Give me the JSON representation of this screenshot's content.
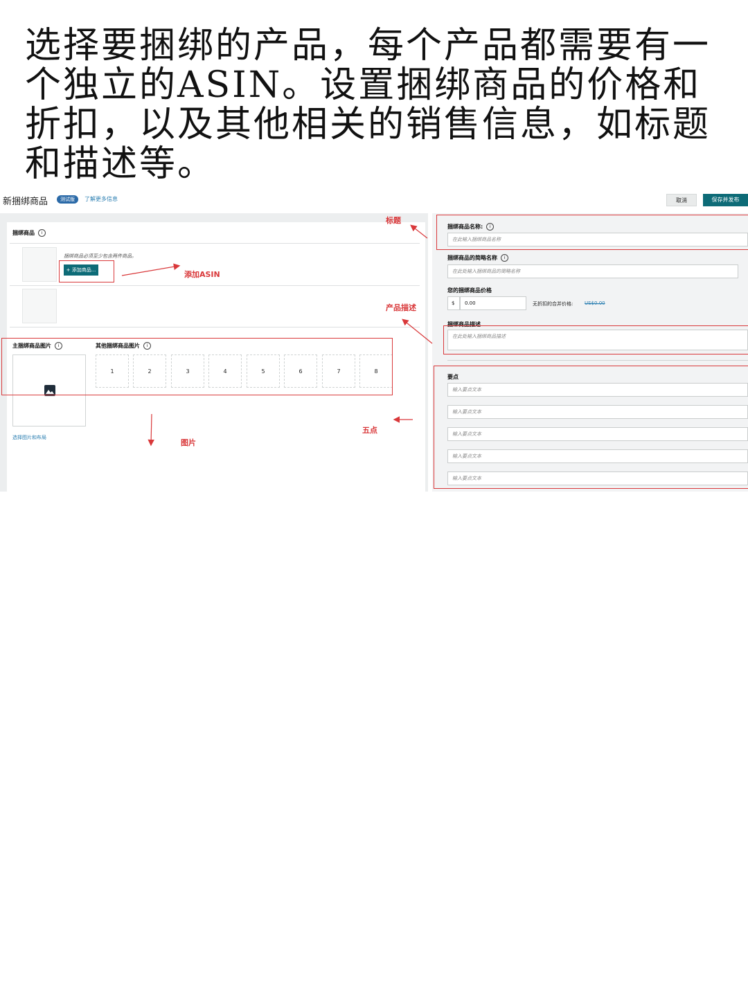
{
  "intro_text": "选择要捆绑的产品，每个产品都需要有一个独立的ASIN。设置捆绑商品的价格和折扣，以及其他相关的销售信息，如标题和描述等。",
  "header": {
    "title": "新捆绑商品",
    "badge": "测试版",
    "learn_more": "了解更多信息",
    "cancel": "取消",
    "save_publish": "保存并发布"
  },
  "left": {
    "section_label": "捆绑商品",
    "hint": "捆绑商品必须至少包含两件商品。",
    "add_button": "+ 添加商品...",
    "main_image_label": "主捆绑商品图片",
    "other_images_label": "其他捆绑商品图片",
    "slots": [
      "1",
      "2",
      "3",
      "4",
      "5",
      "6",
      "7",
      "8"
    ],
    "choose_images_link": "选择图片和布局"
  },
  "right": {
    "name_label": "捆绑商品名称:",
    "name_placeholder": "在此输入捆绑商品名称",
    "short_name_label": "捆绑商品的简略名称",
    "short_name_placeholder": "在此处输入捆绑商品的简略名称",
    "price_label": "您的捆绑商品价格",
    "currency": "$",
    "price_value": "0.00",
    "undiscounted_label": "无折扣的合并价格:",
    "undiscounted_value": "US$0.00",
    "desc_label": "捆绑商品描述",
    "desc_placeholder": "在此处输入捆绑商品描述",
    "bullets_label": "要点",
    "bullet_placeholders": [
      "输入要点文本",
      "输入要点文本",
      "输入要点文本",
      "输入要点文本",
      "输入要点文本"
    ]
  },
  "annotations": {
    "title": "标题",
    "add_asin": "添加ASIN",
    "description": "产品描述",
    "images": "图片",
    "five_points": "五点"
  },
  "colors": {
    "accent": "#0d6b77",
    "annotation": "#d9383a",
    "link": "#2a7eb1"
  }
}
